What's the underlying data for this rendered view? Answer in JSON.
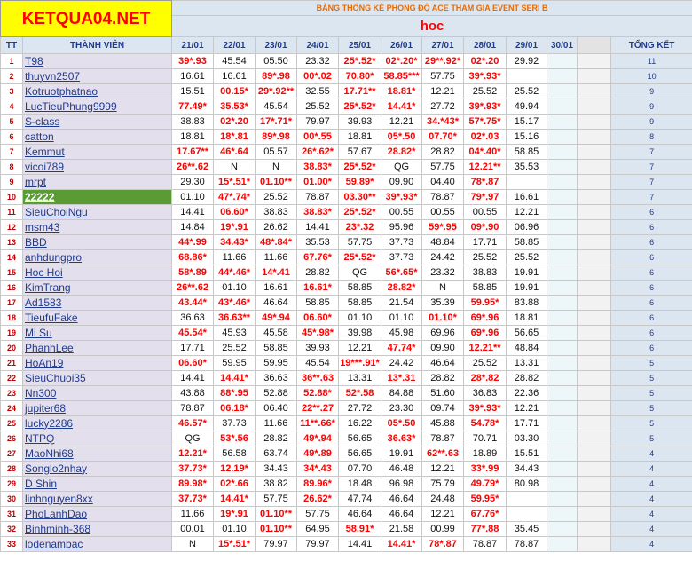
{
  "logo": "KETQUA04.NET",
  "banner_title": "BẢNG THỐNG KÊ PHONG ĐỘ ACE THAM GIA EVENT SERI B",
  "banner_sub": "hoc",
  "headers": {
    "tt": "TT",
    "member": "THÀNH VIÊN",
    "dates": [
      "21/01",
      "22/01",
      "23/01",
      "24/01",
      "25/01",
      "26/01",
      "27/01",
      "28/01",
      "29/01",
      "30/01"
    ],
    "total": "TỔNG KẾT"
  },
  "colors": {
    "highlight_name": "#5b9b35",
    "red_value": "#ff0000",
    "logo_bg": "#ffff00"
  },
  "rows": [
    {
      "tt": "1",
      "name": "T98",
      "vals": [
        "39*.93",
        "45.54",
        "05.50",
        "23.32",
        "25*.52*",
        "02*.20*",
        "29**.92*",
        "02*.20",
        "29.92",
        ""
      ],
      "total": "11"
    },
    {
      "tt": "2",
      "name": "thuyvn2507",
      "vals": [
        "16.61",
        "16.61",
        "89*.98",
        "00*.02",
        "70.80*",
        "58.85***",
        "57.75",
        "39*.93*",
        "",
        ""
      ],
      "total": "10"
    },
    {
      "tt": "3",
      "name": "Kotruotphatnao",
      "vals": [
        "15.51",
        "00.15*",
        "29*.92**",
        "32.55",
        "17.71**",
        "18.81*",
        "12.21",
        "25.52",
        "25.52",
        ""
      ],
      "total": "9"
    },
    {
      "tt": "4",
      "name": "LucTieuPhung9999",
      "vals": [
        "77.49*",
        "35.53*",
        "45.54",
        "25.52",
        "25*.52*",
        "14.41*",
        "27.72",
        "39*.93*",
        "49.94",
        ""
      ],
      "total": "9"
    },
    {
      "tt": "5",
      "name": "S-class",
      "vals": [
        "38.83",
        "02*.20",
        "17*.71*",
        "79.97",
        "39.93",
        "12.21",
        "34.*43*",
        "57*.75*",
        "15.17",
        ""
      ],
      "total": "9"
    },
    {
      "tt": "6",
      "name": "catton",
      "vals": [
        "18.81",
        "18*.81",
        "89*.98",
        "00*.55",
        "18.81",
        "05*.50",
        "07.70*",
        "02*.03",
        "15.16",
        ""
      ],
      "total": "8"
    },
    {
      "tt": "7",
      "name": "Kemmut",
      "vals": [
        "17.67**",
        "46*.64",
        "05.57",
        "26*.62*",
        "57.67",
        "28.82*",
        "28.82",
        "04*.40*",
        "58.85",
        ""
      ],
      "total": "7"
    },
    {
      "tt": "8",
      "name": "vicoi789",
      "vals": [
        "26**.62",
        "N",
        "N",
        "38.83*",
        "25*.52*",
        "QG",
        "57.75",
        "12.21**",
        "35.53",
        ""
      ],
      "total": "7"
    },
    {
      "tt": "9",
      "name": "mrpt",
      "vals": [
        "29.30",
        "15*.51*",
        "01.10**",
        "01.00*",
        "59.89*",
        "09.90",
        "04.40",
        "78*.87",
        "",
        ""
      ],
      "total": "7"
    },
    {
      "tt": "10",
      "name": "22222",
      "vals": [
        "01.10",
        "47*.74*",
        "25.52",
        "78.87",
        "03.30**",
        "39*.93*",
        "78.87",
        "79*.97",
        "16.61",
        ""
      ],
      "total": "7"
    },
    {
      "tt": "11",
      "name": "SieuChoiNgu",
      "vals": [
        "14.41",
        "06.60*",
        "38.83",
        "38.83*",
        "25*.52*",
        "00.55",
        "00.55",
        "00.55",
        "12.21",
        ""
      ],
      "total": "6"
    },
    {
      "tt": "12",
      "name": "msm43",
      "vals": [
        "14.84",
        "19*.91",
        "26.62",
        "14.41",
        "23*.32",
        "95.96",
        "59*.95",
        "09*.90",
        "06.96",
        ""
      ],
      "total": "6"
    },
    {
      "tt": "13",
      "name": "BBD",
      "vals": [
        "44*.99",
        "34.43*",
        "48*.84*",
        "35.53",
        "57.75",
        "37.73",
        "48.84",
        "17.71",
        "58.85",
        ""
      ],
      "total": "6"
    },
    {
      "tt": "14",
      "name": "anhdungpro",
      "vals": [
        "68.86*",
        "11.66",
        "11.66",
        "67.76*",
        "25*.52*",
        "37.73",
        "24.42",
        "25.52",
        "25.52",
        ""
      ],
      "total": "6"
    },
    {
      "tt": "15",
      "name": "Hoc Hoi",
      "vals": [
        "58*.89",
        "44*.46*",
        "14*.41",
        "28.82",
        "QG",
        "56*.65*",
        "23.32",
        "38.83",
        "19.91",
        ""
      ],
      "total": "6"
    },
    {
      "tt": "16",
      "name": "KimTrang",
      "vals": [
        "26**.62",
        "01.10",
        "16.61",
        "16.61*",
        "58.85",
        "28.82*",
        "N",
        "58.85",
        "19.91",
        ""
      ],
      "total": "6"
    },
    {
      "tt": "17",
      "name": "Ad1583",
      "vals": [
        "43.44*",
        "43*.46*",
        "46.64",
        "58.85",
        "58.85",
        "21.54",
        "35.39",
        "59.95*",
        "83.88",
        ""
      ],
      "total": "6"
    },
    {
      "tt": "18",
      "name": "TieufuFake",
      "vals": [
        "36.63",
        "36.63**",
        "49*.94",
        "06.60*",
        "01.10",
        "01.10",
        "01.10*",
        "69*.96",
        "18.81",
        ""
      ],
      "total": "6"
    },
    {
      "tt": "19",
      "name": "Mi Su",
      "vals": [
        "45.54*",
        "45.93",
        "45.58",
        "45*.98*",
        "39.98",
        "45.98",
        "69.96",
        "69*.96",
        "56.65",
        ""
      ],
      "total": "6"
    },
    {
      "tt": "20",
      "name": "PhanhLee",
      "vals": [
        "17.71",
        "25.52",
        "58.85",
        "39.93",
        "12.21",
        "47.74*",
        "09.90",
        "12.21**",
        "48.84",
        ""
      ],
      "total": "6"
    },
    {
      "tt": "21",
      "name": "HoAn19",
      "vals": [
        "06.60*",
        "59.95",
        "59.95",
        "45.54",
        "19***.91*",
        "24.42",
        "46.64",
        "25.52",
        "13.31",
        ""
      ],
      "total": "5"
    },
    {
      "tt": "22",
      "name": "SieuChuoi35",
      "vals": [
        "14.41",
        "14.41*",
        "36.63",
        "36**.63",
        "13.31",
        "13*.31",
        "28.82",
        "28*.82",
        "28.82",
        ""
      ],
      "total": "5"
    },
    {
      "tt": "23",
      "name": "Nn300",
      "vals": [
        "43.88",
        "88*.95",
        "52.88",
        "52.88*",
        "52*.58",
        "84.88",
        "51.60",
        "36.83",
        "22.36",
        ""
      ],
      "total": "5"
    },
    {
      "tt": "24",
      "name": "jupiter68",
      "vals": [
        "78.87",
        "06.18*",
        "06.40",
        "22**.27",
        "27.72",
        "23.30",
        "09.74",
        "39*.93*",
        "12.21",
        ""
      ],
      "total": "5"
    },
    {
      "tt": "25",
      "name": "lucky2286",
      "vals": [
        "46.57*",
        "37.73",
        "11.66",
        "11**.66*",
        "16.22",
        "05*.50",
        "45.88",
        "54.78*",
        "17.71",
        ""
      ],
      "total": "5"
    },
    {
      "tt": "26",
      "name": "NTPQ",
      "vals": [
        "QG",
        "53*.56",
        "28.82",
        "49*.94",
        "56.65",
        "36.63*",
        "78.87",
        "70.71",
        "03.30",
        ""
      ],
      "total": "5"
    },
    {
      "tt": "27",
      "name": "MaoNhi68",
      "vals": [
        "12.21*",
        "56.58",
        "63.74",
        "49*.89",
        "56.65",
        "19.91",
        "62**.63",
        "18.89",
        "15.51",
        ""
      ],
      "total": "4"
    },
    {
      "tt": "28",
      "name": "Songlo2nhay",
      "vals": [
        "37.73*",
        "12.19*",
        "34.43",
        "34*.43",
        "07.70",
        "46.48",
        "12.21",
        "33*.99",
        "34.43",
        ""
      ],
      "total": "4"
    },
    {
      "tt": "29",
      "name": "D Shin",
      "vals": [
        "89.98*",
        "02*.66",
        "38.82",
        "89.96*",
        "18.48",
        "96.98",
        "75.79",
        "49.79*",
        "80.98",
        ""
      ],
      "total": "4"
    },
    {
      "tt": "30",
      "name": "linhnguyen8xx",
      "vals": [
        "37.73*",
        "14.41*",
        "57.75",
        "26.62*",
        "47.74",
        "46.64",
        "24.48",
        "59.95*",
        "",
        ""
      ],
      "total": "4"
    },
    {
      "tt": "31",
      "name": "PhoLanhDao",
      "vals": [
        "11.66",
        "19*.91",
        "01.10**",
        "57.75",
        "46.64",
        "46.64",
        "12.21",
        "67.76*",
        "",
        ""
      ],
      "total": "4"
    },
    {
      "tt": "32",
      "name": "Binhminh-368",
      "vals": [
        "00.01",
        "01.10",
        "01.10**",
        "64.95",
        "58.91*",
        "21.58",
        "00.99",
        "77*.88",
        "35.45",
        ""
      ],
      "total": "4"
    },
    {
      "tt": "33",
      "name": "lodenambac",
      "vals": [
        "N",
        "15*.51*",
        "79.97",
        "79.97",
        "14.41",
        "14.41*",
        "78*.87",
        "78.87",
        "78.87",
        ""
      ],
      "total": "4"
    }
  ]
}
